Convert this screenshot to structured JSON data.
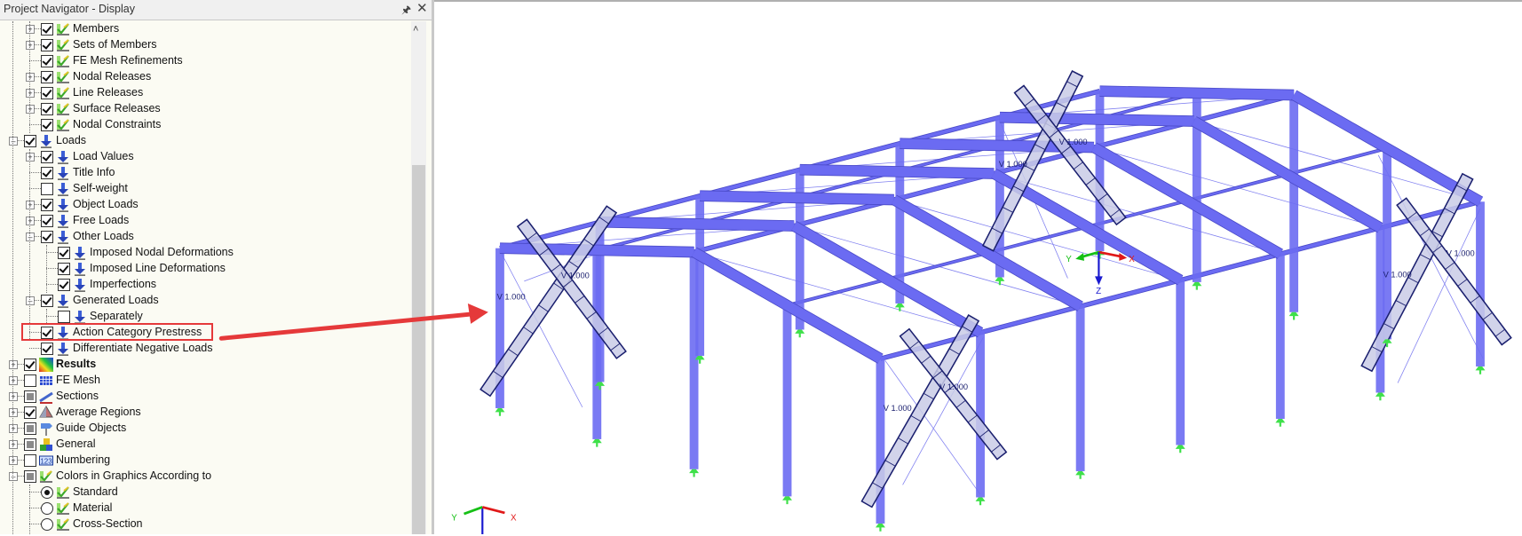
{
  "navigator": {
    "title": "Project Navigator - Display",
    "pin_icon": "pin-icon",
    "close_icon": "close-icon"
  },
  "tree": [
    {
      "label": "Members",
      "level": 2,
      "exp": "+",
      "state": "checked",
      "icon": "display"
    },
    {
      "label": "Sets of Members",
      "level": 2,
      "exp": "+",
      "state": "checked",
      "icon": "display"
    },
    {
      "label": "FE Mesh Refinements",
      "level": 2,
      "exp": "",
      "state": "checked",
      "icon": "display"
    },
    {
      "label": "Nodal Releases",
      "level": 2,
      "exp": "+",
      "state": "checked",
      "icon": "display"
    },
    {
      "label": "Line Releases",
      "level": 2,
      "exp": "+",
      "state": "checked",
      "icon": "display"
    },
    {
      "label": "Surface Releases",
      "level": 2,
      "exp": "+",
      "state": "checked",
      "icon": "display"
    },
    {
      "label": "Nodal Constraints",
      "level": 2,
      "exp": "",
      "state": "checked",
      "icon": "display"
    },
    {
      "label": "Loads",
      "level": 1,
      "exp": "-",
      "state": "checked",
      "icon": "load"
    },
    {
      "label": "Load Values",
      "level": 2,
      "exp": "+",
      "state": "checked",
      "icon": "load"
    },
    {
      "label": "Title Info",
      "level": 2,
      "exp": "",
      "state": "checked",
      "icon": "load"
    },
    {
      "label": "Self-weight",
      "level": 2,
      "exp": "",
      "state": "unchecked",
      "icon": "load"
    },
    {
      "label": "Object Loads",
      "level": 2,
      "exp": "+",
      "state": "checked",
      "icon": "load"
    },
    {
      "label": "Free Loads",
      "level": 2,
      "exp": "+",
      "state": "checked",
      "icon": "load"
    },
    {
      "label": "Other Loads",
      "level": 2,
      "exp": "-",
      "state": "checked",
      "icon": "load"
    },
    {
      "label": "Imposed Nodal Deformations",
      "level": 3,
      "exp": "",
      "state": "checked",
      "icon": "load"
    },
    {
      "label": "Imposed Line Deformations",
      "level": 3,
      "exp": "",
      "state": "checked",
      "icon": "load"
    },
    {
      "label": "Imperfections",
      "level": 3,
      "exp": "",
      "state": "checked",
      "icon": "load"
    },
    {
      "label": "Generated Loads",
      "level": 2,
      "exp": "-",
      "state": "checked",
      "icon": "load"
    },
    {
      "label": "Separately",
      "level": 3,
      "exp": "",
      "state": "unchecked",
      "icon": "load"
    },
    {
      "label": "Action Category Prestress",
      "level": 2,
      "exp": "",
      "state": "checked",
      "icon": "load",
      "highlighted": true
    },
    {
      "label": "Differentiate Negative Loads",
      "level": 2,
      "exp": "",
      "state": "checked",
      "icon": "load"
    },
    {
      "label": "Results",
      "level": 1,
      "exp": "+",
      "state": "checked",
      "icon": "results",
      "bold": true
    },
    {
      "label": "FE Mesh",
      "level": 1,
      "exp": "+",
      "state": "unchecked",
      "icon": "mesh"
    },
    {
      "label": "Sections",
      "level": 1,
      "exp": "+",
      "state": "partial",
      "icon": "sections"
    },
    {
      "label": "Average Regions",
      "level": 1,
      "exp": "+",
      "state": "checked",
      "icon": "average"
    },
    {
      "label": "Guide Objects",
      "level": 1,
      "exp": "+",
      "state": "partial",
      "icon": "guide"
    },
    {
      "label": "General",
      "level": 1,
      "exp": "+",
      "state": "partial",
      "icon": "general"
    },
    {
      "label": "Numbering",
      "level": 1,
      "exp": "+",
      "state": "unchecked",
      "icon": "numbering"
    },
    {
      "label": "Colors in Graphics According to",
      "level": 1,
      "exp": "-",
      "state": "partial",
      "icon": "display"
    },
    {
      "label": "Standard",
      "level": 2,
      "exp": "",
      "state": "radio-selected",
      "icon": "display"
    },
    {
      "label": "Material",
      "level": 2,
      "exp": "",
      "state": "radio",
      "icon": "display"
    },
    {
      "label": "Cross-Section",
      "level": 2,
      "exp": "",
      "state": "radio",
      "icon": "display"
    }
  ],
  "viewport": {
    "member_labels": [
      "V 1.000",
      "V 1.000",
      "V 1.000",
      "V 1.000",
      "V 1.000",
      "V 1.000",
      "V 1.000",
      "V 1.000"
    ],
    "axis_center": {
      "x": "X",
      "y": "Y",
      "z": "Z"
    },
    "axis_corner": {
      "x": "X",
      "y": "Y"
    }
  },
  "colors": {
    "member": "#6b6bf2",
    "member_edge": "#4a4ac8",
    "brace_fill": "#c9cbe6",
    "brace_edge": "#1a1f6e",
    "support": "#3fe04a",
    "highlight": "#e5393a",
    "panel_bg": "#fbfbf3"
  }
}
